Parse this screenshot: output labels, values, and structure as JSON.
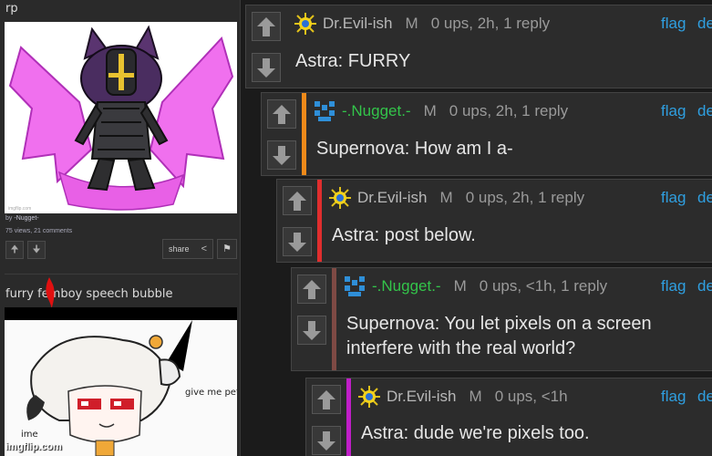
{
  "colors": {
    "link_blue": "#2f9fe0",
    "nugget_green": "#33c44a",
    "evil_gray": "#b8b8b8",
    "accent_orange": "#ef8a1a",
    "accent_red": "#e02e2e",
    "accent_brown": "#7e4a44",
    "accent_magenta": "#c01ec8"
  },
  "left_panel": {
    "post1": {
      "title": "rp",
      "by_prefix": "by",
      "by_user": "-Nugget-",
      "stats": "75 views, 21 comments",
      "share_label": "share"
    },
    "post2": {
      "title": "furry femboy speech bubble",
      "speech_text": "give me pets!!",
      "side_text": "ime"
    },
    "watermark": "imgflip.com"
  },
  "comments": [
    {
      "avatar": "sun-icon",
      "user": "Dr.Evil-ish",
      "gender": "M",
      "stats": "0 ups, 2h, 1 reply",
      "flag": "flag",
      "extra": "de",
      "lines": [
        "Astra: FURRY"
      ]
    },
    {
      "avatar": "pixel-icon",
      "user": "-.Nugget.-",
      "gender": "M",
      "stats": "0 ups, 2h, 1 reply",
      "flag": "flag",
      "extra": "de",
      "lines": [
        "Supernova: How am I a-"
      ]
    },
    {
      "avatar": "sun-icon",
      "user": "Dr.Evil-ish",
      "gender": "M",
      "stats": "0 ups, 2h, 1 reply",
      "flag": "flag",
      "extra": "de",
      "lines": [
        "Astra: post below."
      ]
    },
    {
      "avatar": "pixel-icon",
      "user": "-.Nugget.-",
      "gender": "M",
      "stats": "0 ups, <1h, 1 reply",
      "flag": "flag",
      "extra": "de",
      "lines": [
        "Supernova: You let pixels on a screen",
        "interfere with the real world?"
      ]
    },
    {
      "avatar": "sun-icon",
      "user": "Dr.Evil-ish",
      "gender": "M",
      "stats": "0 ups, <1h",
      "flag": "flag",
      "extra": "de",
      "lines": [
        "Astra: dude we're pixels too."
      ]
    }
  ]
}
